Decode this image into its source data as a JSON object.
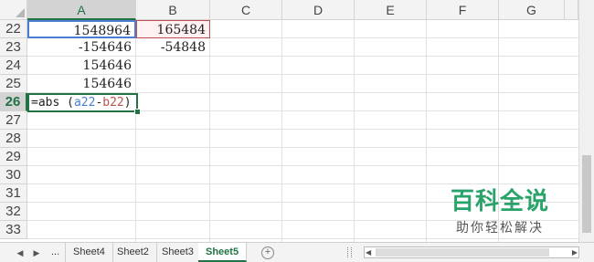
{
  "columns": [
    "A",
    "B",
    "C",
    "D",
    "E",
    "F",
    "G"
  ],
  "rows": [
    "22",
    "23",
    "24",
    "25",
    "26",
    "27",
    "28",
    "29",
    "30",
    "31",
    "32",
    "33"
  ],
  "cells": {
    "a22": "1548964",
    "b22": "165484",
    "a23": "-154646",
    "b23": "-54848",
    "a24": "154646",
    "a25": "154646"
  },
  "formula": {
    "prefix": "=abs (",
    "ref_a": "a22",
    "minus": "-",
    "ref_b": "b22",
    "suffix": ")"
  },
  "tabs": {
    "ellipsis": "...",
    "sheet4": "Sheet4",
    "sheet2": "Sheet2",
    "sheet3": "Sheet3",
    "sheet5": "Sheet5",
    "add": "+"
  },
  "watermark": {
    "title": "百科全说",
    "subtitle": "助你轻松解决"
  },
  "colors": {
    "accent": "#217346",
    "ref_a": "#4a7ed0",
    "ref_b": "#c0504d",
    "watermark": "#2aa36a"
  }
}
